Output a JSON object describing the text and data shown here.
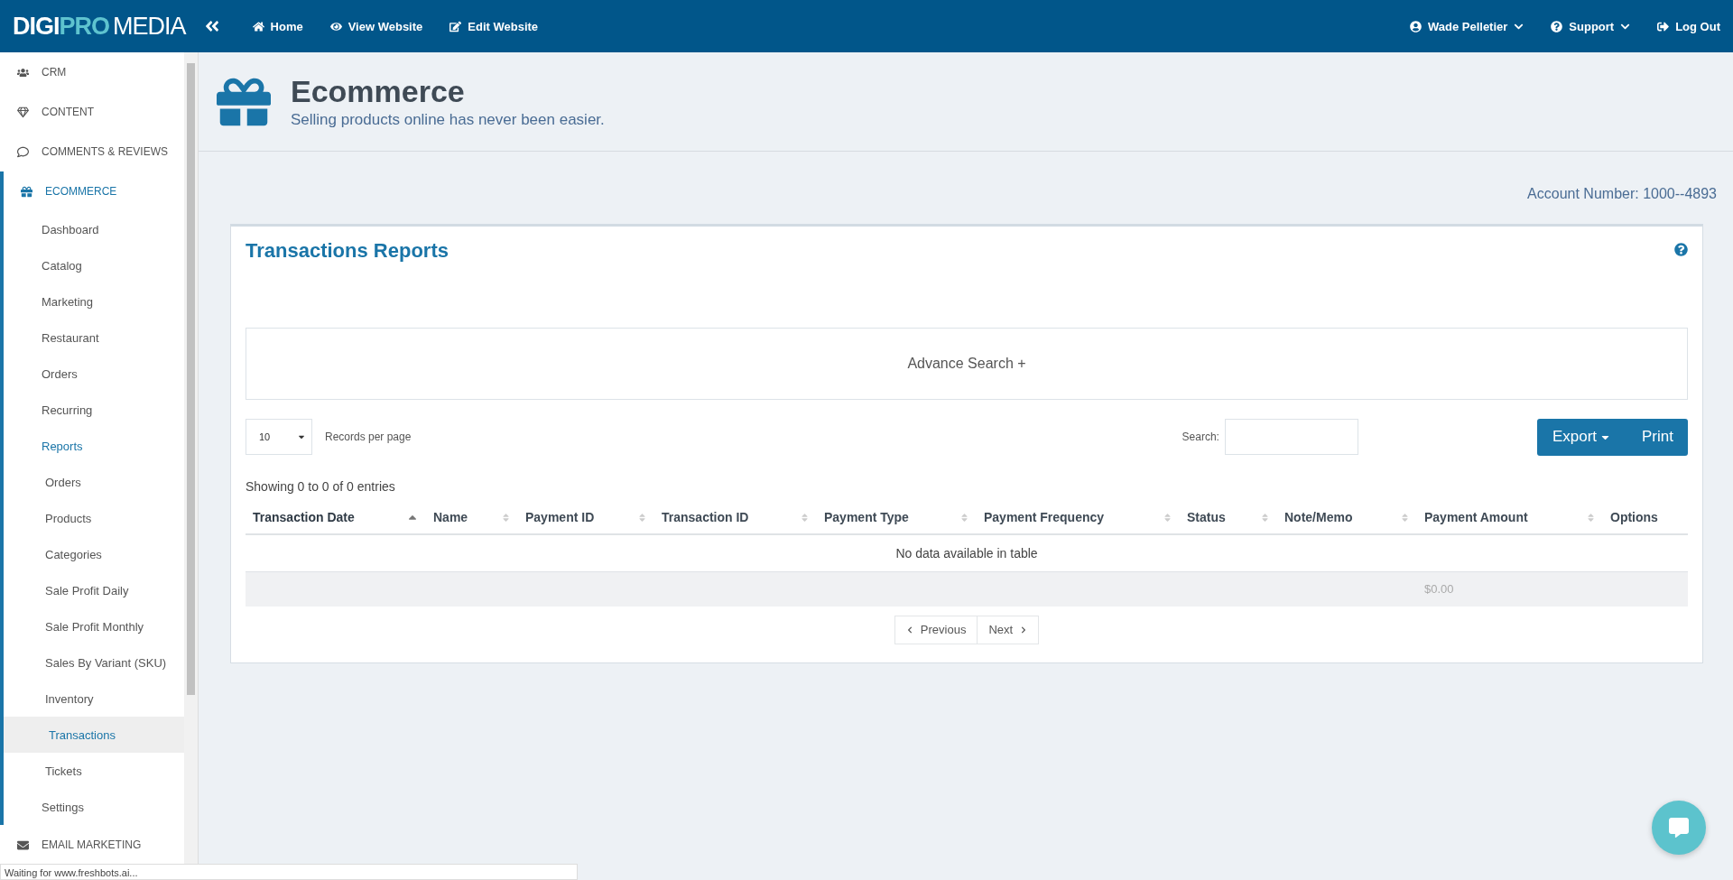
{
  "topbar": {
    "logo": [
      "DIGI",
      "PRO",
      "MEDIA"
    ],
    "nav": [
      {
        "label": "Home"
      },
      {
        "label": "View Website"
      },
      {
        "label": "Edit Website"
      }
    ],
    "user": "Wade Pelletier",
    "support": "Support",
    "logout": "Log Out"
  },
  "sidebar": {
    "items": [
      {
        "label": "CRM",
        "expanded": false
      },
      {
        "label": "CONTENT",
        "expanded": false
      },
      {
        "label": "COMMENTS & REVIEWS",
        "expanded": false
      },
      {
        "label": "ECOMMERCE",
        "expanded": true,
        "children": [
          {
            "label": "Dashboard",
            "selected": false
          },
          {
            "label": "Catalog",
            "selected": false
          },
          {
            "label": "Marketing",
            "selected": false
          },
          {
            "label": "Restaurant",
            "selected": false
          },
          {
            "label": "Orders",
            "selected": false
          },
          {
            "label": "Recurring",
            "selected": false
          },
          {
            "label": "Reports",
            "selected": false,
            "expanded": true,
            "children": [
              {
                "label": "Orders",
                "selected": false
              },
              {
                "label": "Products",
                "selected": false
              },
              {
                "label": "Categories",
                "selected": false
              },
              {
                "label": "Sale Profit Daily",
                "selected": false
              },
              {
                "label": "Sale Profit Monthly",
                "selected": false
              },
              {
                "label": "Sales By Variant (SKU)",
                "selected": false
              },
              {
                "label": "Inventory",
                "selected": false
              },
              {
                "label": "Transactions",
                "selected": true
              },
              {
                "label": "Tickets",
                "selected": false
              }
            ]
          },
          {
            "label": "Settings",
            "selected": false
          }
        ]
      },
      {
        "label": "EMAIL MARKETING",
        "expanded": false
      }
    ]
  },
  "header": {
    "title": "Ecommerce",
    "subtitle": "Selling products online has never been easier."
  },
  "account_number": "Account Number: 1000--4893",
  "card": {
    "title": "Transactions Reports",
    "advance_search": "Advance Search +",
    "page_size": {
      "value": "10",
      "label": "Records per page"
    },
    "search": {
      "label": "Search:"
    },
    "buttons": [
      {
        "label": "Export",
        "kind": "dropdown"
      },
      {
        "label": "Print",
        "kind": "plain"
      }
    ],
    "info": "Showing 0 to 0 of 0 entries",
    "table": {
      "columns": [
        {
          "label": "Transaction Date",
          "sortable": true,
          "sorted": true
        },
        {
          "label": "Name",
          "sortable": true,
          "sorted": false
        },
        {
          "label": "Payment ID",
          "sortable": true,
          "sorted": false
        },
        {
          "label": "Transaction ID",
          "sortable": true,
          "sorted": false
        },
        {
          "label": "Payment Type",
          "sortable": true,
          "sorted": false
        },
        {
          "label": "Payment Frequency",
          "sortable": true,
          "sorted": false
        },
        {
          "label": "Status",
          "sortable": true,
          "sorted": false
        },
        {
          "label": "Note/Memo",
          "sortable": true,
          "sorted": false
        },
        {
          "label": "Payment Amount",
          "sortable": true,
          "sorted": false
        },
        {
          "label": "Options",
          "sortable": false
        }
      ],
      "empty": "No data available in table",
      "footer": {
        "payment_amount": "$0.00"
      }
    },
    "pagination": [
      {
        "label": "Previous",
        "kind": "prev"
      },
      {
        "label": "Next",
        "kind": "next"
      }
    ]
  },
  "status_bar": "Waiting for www.freshbots.ai..."
}
